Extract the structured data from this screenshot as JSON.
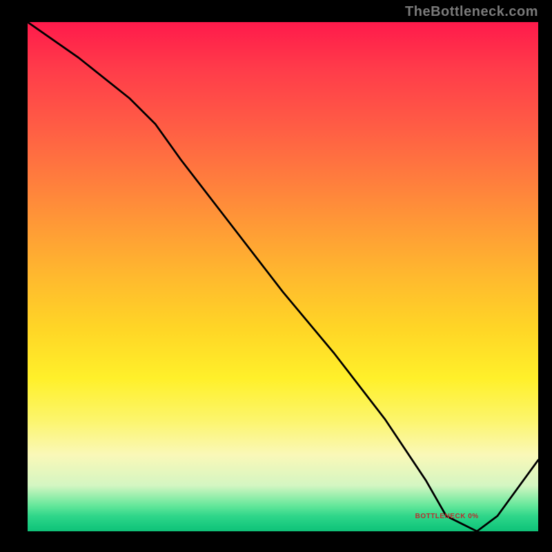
{
  "watermark": "TheBottleneck.com",
  "inner_label": "BOTTLENECK 0%",
  "chart_data": {
    "type": "line",
    "title": "",
    "xlabel": "",
    "ylabel": "",
    "xlim": [
      0,
      100
    ],
    "ylim": [
      0,
      100
    ],
    "series": [
      {
        "name": "bottleneck-curve",
        "x": [
          0,
          10,
          20,
          25,
          30,
          40,
          50,
          60,
          70,
          78,
          82,
          88,
          92,
          100
        ],
        "y": [
          100,
          93,
          85,
          80,
          73,
          60,
          47,
          35,
          22,
          10,
          3,
          0,
          3,
          14
        ]
      }
    ],
    "annotations": [
      {
        "text": "BOTTLENECK 0%",
        "x": 84,
        "y": 2
      }
    ],
    "background_gradient": {
      "top": "#ff1a4b",
      "bottom": "#10c178"
    }
  }
}
